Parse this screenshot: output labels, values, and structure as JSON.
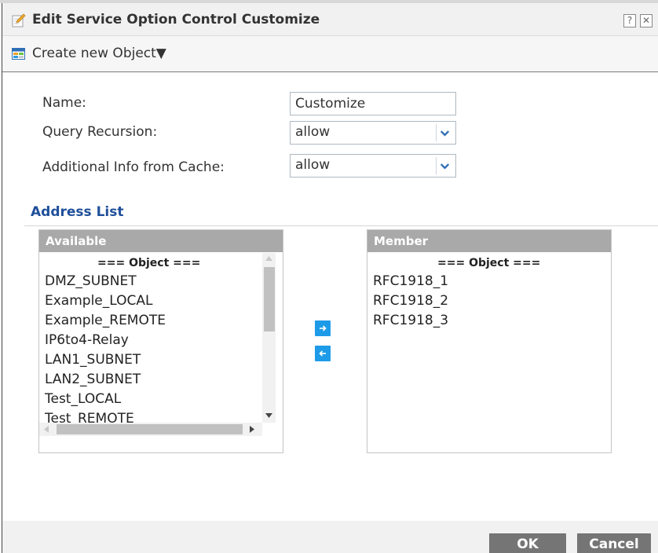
{
  "window": {
    "title": "Edit Service Option Control Customize",
    "help_label": "?",
    "close_label": "✕"
  },
  "toolbar": {
    "create_object_label": "Create new Object▼",
    "icon": "object-table-icon"
  },
  "form": {
    "name_label": "Name:",
    "name_value": "Customize",
    "query_recursion_label": "Query Recursion:",
    "query_recursion_value": "allow",
    "additional_info_label": "Additional Info from Cache:",
    "additional_info_value": "allow"
  },
  "address_list": {
    "title": "Address List",
    "available": {
      "header": "Available",
      "group_label": "=== Object ===",
      "items": [
        "DMZ_SUBNET",
        "Example_LOCAL",
        "Example_REMOTE",
        "IP6to4-Relay",
        "LAN1_SUBNET",
        "LAN2_SUBNET",
        "Test_LOCAL",
        "Test_REMOTE"
      ]
    },
    "member": {
      "header": "Member",
      "group_label": "=== Object ===",
      "items": [
        "RFC1918_1",
        "RFC1918_2",
        "RFC1918_3"
      ]
    },
    "add_arrow": "→",
    "remove_arrow": "←"
  },
  "buttons": {
    "ok_label": "OK",
    "cancel_label": "Cancel"
  },
  "colors": {
    "accent": "#1e9be8",
    "section_title": "#1f4f9a",
    "list_header": "#a9a9a9",
    "button": "#757575"
  }
}
